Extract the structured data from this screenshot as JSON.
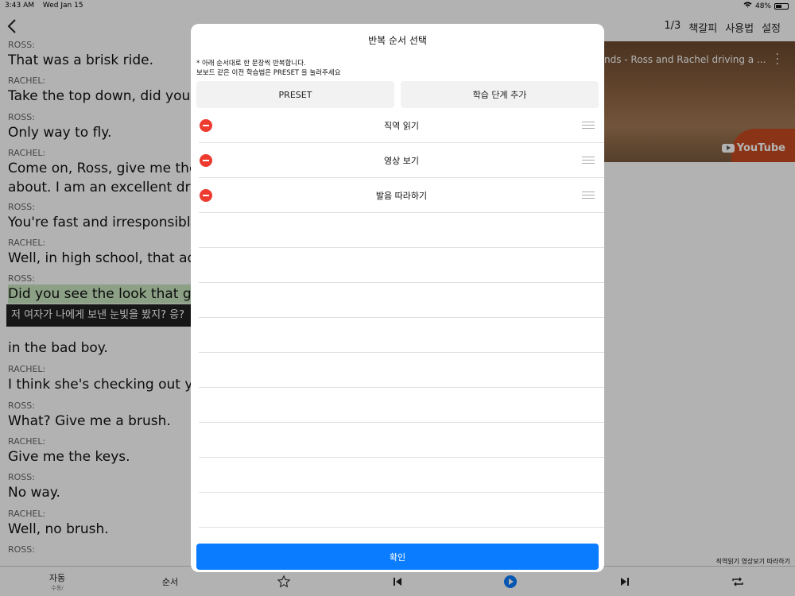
{
  "status": {
    "time": "3:43 AM",
    "date": "Wed Jan 15",
    "battery": "48%"
  },
  "nav": {
    "page": "1/3",
    "bookmark": "책갈피",
    "howto": "사용법",
    "settings": "설정"
  },
  "script": [
    {
      "speaker": "ROSS:",
      "text": "That was a brisk ride."
    },
    {
      "speaker": "RACHEL:",
      "text": "Take the top down, did you?"
    },
    {
      "speaker": "ROSS:",
      "text": "Only way to fly."
    },
    {
      "speaker": "RACHEL:",
      "text": "Come on, Ross, give me the",
      "text2": "about. I am an excellent drive"
    },
    {
      "speaker": "ROSS:",
      "text": "You're fast and irresponsible"
    },
    {
      "speaker": "RACHEL:",
      "text": "Well, in high school, that add"
    },
    {
      "speaker": "ROSS:",
      "text": "Did you see the look that girl",
      "highlight": true
    },
    {
      "speaker": "",
      "text": "in the bad boy."
    },
    {
      "speaker": "RACHEL:",
      "text": "I think she's checking out yo"
    },
    {
      "speaker": "ROSS:",
      "text": "What? Give me a brush."
    },
    {
      "speaker": "RACHEL:",
      "text": "Give me the keys."
    },
    {
      "speaker": "ROSS:",
      "text": "No way."
    },
    {
      "speaker": "RACHEL:",
      "text": "Well, no brush."
    },
    {
      "speaker": "ROSS:",
      "text": ""
    }
  ],
  "translation": "저 여자가 나에게 보낸 눈빛을 봤지? 응?",
  "video": {
    "title": "nds - Ross and Rachel driving a ...",
    "brand": "YouTube"
  },
  "sequence_label": "직역읽기 영상보기 따라하기",
  "bottombar": {
    "auto": "자동",
    "auto_sub": "수동/",
    "order": "순서"
  },
  "modal": {
    "title": "반복 순서 선택",
    "desc1": "* 아래 순서대로 한 문장씩 반복합니다.",
    "desc2": "보보드 같은 이전 학습법은 PRESET 을 눌러주세요",
    "preset": "PRESET",
    "add_step": "학습 단계 추가",
    "steps": [
      "직역 읽기",
      "영상 보기",
      "발음 따라하기"
    ],
    "confirm": "확인"
  }
}
